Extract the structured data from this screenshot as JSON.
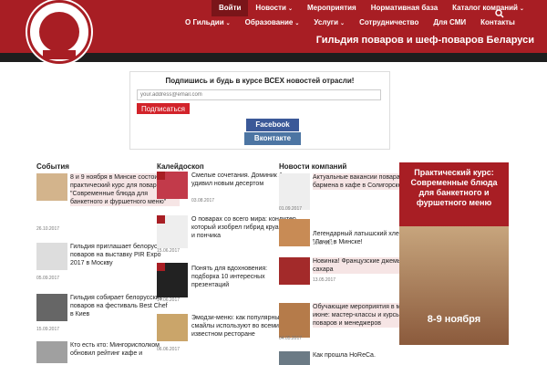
{
  "header": {
    "site_title": "Гильдия поваров и шеф-поваров Беларуси",
    "brand_color": "#a81e24",
    "nav_top": [
      "Войти",
      "Новости",
      "Мероприятия",
      "Нормативная база",
      "Каталог компаний"
    ],
    "nav_bottom": [
      "О Гильдии",
      "Образование",
      "Услуги",
      "Сотрудничество",
      "Для СМИ",
      "Контакты"
    ],
    "caret": "⌄"
  },
  "subscribe": {
    "text": "Подпишись и будь в курсе ВСЕХ новостей отрасли!",
    "placeholder": "your.address@email.com",
    "button": "Подписаться",
    "facebook": "Facebook",
    "vkontakte": "Вконтакте"
  },
  "columns": {
    "events": {
      "title": "События",
      "items": [
        {
          "text": "8 и 9 ноября в Минске состоится практический курс для поваров – \"Современные блюда для банкетного и фуршетного меню\"",
          "date": "26.10.2017"
        },
        {
          "text": "Гильдия приглашает белорусских поваров на выставку PIR Expo 2017 в Москву",
          "date": "05.09.2017"
        },
        {
          "text": "Гильдия собирает белорусских поваров на фестиваль Best Chef в Киев",
          "date": "15.09.2017"
        },
        {
          "text": "Кто есть кто: Мингорисполком обновил рейтинг кафе и",
          "date": ""
        }
      ]
    },
    "kaleidoscope": {
      "title": "Калейдоскоп",
      "items": [
        {
          "text": "Смелые сочетания. Доминик Ансель удивил новым десертом",
          "date": "03.08.2017"
        },
        {
          "text": "О поварах со всего мира: кондитер, который изобрел гибрид круассана и пончика",
          "date": "15.06.2017"
        },
        {
          "text": "Понять для вдохновения: подборка 10 интересных презентаций",
          "date": "14.06.2017"
        },
        {
          "text": "Эмодзи-меню: как популярные смайлы используют во всемирно известном ресторане",
          "date": "06.06.2017"
        }
      ]
    },
    "company_news": {
      "title": "Новости компаний",
      "items": [
        {
          "text": "Актуальные вакансии повара и бармена в кафе в Солигорске",
          "date": "01.09.2017"
        },
        {
          "text": "Легендарный латышский хлеб \"Лачи\" в Минске!",
          "date": "19.07.2017"
        },
        {
          "text": "Новинка! Французские джемы без сахара",
          "date": "13.05.2017"
        },
        {
          "text": "Обучающие мероприятия в мае-июне: мастер-классы и курсы для поваров и менеджеров",
          "date": "04.05.2017"
        },
        {
          "text": "Как прошла HoReCa.",
          "date": ""
        }
      ]
    }
  },
  "ad": {
    "title": "Практический курс: Современные блюда для банкетного и фуршетного меню",
    "date": "8-9 ноября"
  }
}
